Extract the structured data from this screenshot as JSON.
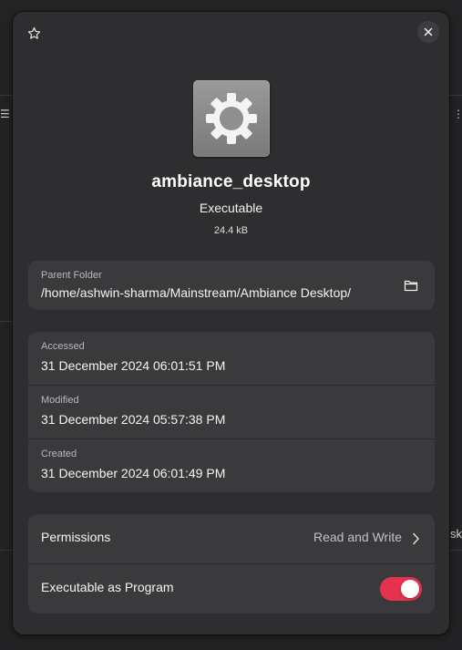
{
  "dialog": {
    "file_name": "ambiance_desktop",
    "file_type": "Executable",
    "file_size": "24.4 kB",
    "icon": "gear-icon"
  },
  "parent_folder": {
    "label": "Parent Folder",
    "path": "/home/ashwin-sharma/Mainstream/Ambiance Desktop/",
    "open_icon": "folder-icon"
  },
  "dates": [
    {
      "label": "Accessed",
      "value": "31 December 2024 06:01:51 PM"
    },
    {
      "label": "Modified",
      "value": "31 December 2024 05:57:38 PM"
    },
    {
      "label": "Created",
      "value": "31 December 2024 06:01:49 PM"
    }
  ],
  "permissions": {
    "label": "Permissions",
    "value": "Read and Write"
  },
  "executable": {
    "label": "Executable as Program",
    "enabled": true,
    "accent_color": "#e5334f"
  },
  "background": {
    "partial_text": "sk"
  },
  "header": {
    "star_icon": "star-icon",
    "close_icon": "close-icon"
  }
}
